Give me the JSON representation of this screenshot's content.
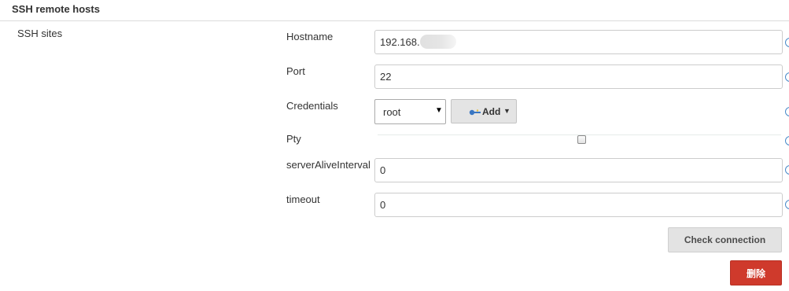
{
  "section": {
    "title": "SSH remote hosts"
  },
  "sites": {
    "label": "SSH sites"
  },
  "fields": {
    "hostname": {
      "label": "Hostname",
      "value": "192.168."
    },
    "port": {
      "label": "Port",
      "value": "22"
    },
    "credentials": {
      "label": "Credentials",
      "selected": "root",
      "add_label": "Add"
    },
    "pty": {
      "label": "Pty",
      "checked": false
    },
    "server_alive_interval": {
      "label": "serverAliveInterval",
      "value": "0"
    },
    "timeout": {
      "label": "timeout",
      "value": "0"
    }
  },
  "buttons": {
    "check_connection": "Check connection",
    "delete": "删除"
  },
  "icons": {
    "help": "help-icon",
    "credentials_key": "key-icon",
    "select_arrow": "dropdown-arrow-icon",
    "add_caret": "caret-down-icon"
  },
  "colors": {
    "help_icon": "#4a8ac9",
    "delete_button": "#cf3a2c",
    "secondary_button": "#e3e3e3",
    "key_icon": "#3a77c2"
  }
}
